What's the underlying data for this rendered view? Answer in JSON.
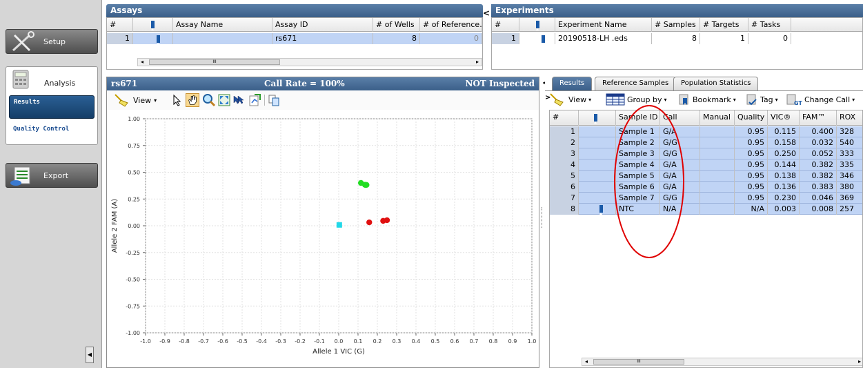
{
  "nav": {
    "setup_label": "Setup",
    "analysis_label": "Analysis",
    "results_label": "Results",
    "qc_label": "Quality Control",
    "export_label": "Export"
  },
  "assays": {
    "title": "Assays",
    "columns": [
      "#",
      "",
      "Assay Name",
      "Assay ID",
      "# of Wells",
      "# of Reference..."
    ],
    "rows": [
      {
        "num": "1",
        "assay_name": "",
        "assay_id": "rs671",
        "wells": "8",
        "ref": "0"
      }
    ]
  },
  "experiments": {
    "title": "Experiments",
    "columns": [
      "#",
      "",
      "Experiment Name",
      "# Samples",
      "# Targets",
      "# Tasks"
    ],
    "rows": [
      {
        "num": "1",
        "name": "20190518-LH  .eds",
        "samples": "8",
        "targets": "1",
        "tasks": "0"
      }
    ]
  },
  "plot": {
    "title": "rs671",
    "call_rate": "Call Rate = 100%",
    "status": "NOT Inspected",
    "view_label": "View"
  },
  "chart_data": {
    "type": "scatter",
    "xlabel": "Allele 1 VIC (G)",
    "ylabel": "Allele 2 FAM (A)",
    "xlim": [
      -1.0,
      1.0
    ],
    "ylim": [
      -1.0,
      1.0
    ],
    "xticks": [
      "-1.0",
      "-0.9",
      "-0.8",
      "-0.7",
      "-0.6",
      "-0.5",
      "-0.4",
      "-0.3",
      "-0.2",
      "-0.1",
      "0.0",
      "0.1",
      "0.2",
      "0.3",
      "0.4",
      "0.5",
      "0.6",
      "0.7",
      "0.8",
      "0.9",
      "1.0"
    ],
    "yticks": [
      "1.00",
      "0.75",
      "0.50",
      "0.25",
      "0.00",
      "-0.25",
      "-0.50",
      "-0.75",
      "-1.00"
    ],
    "grid": true,
    "points": [
      {
        "x": 0.115,
        "y": 0.4,
        "color": "#22dd22",
        "shape": "circle"
      },
      {
        "x": 0.144,
        "y": 0.382,
        "color": "#22dd22",
        "shape": "circle"
      },
      {
        "x": 0.138,
        "y": 0.382,
        "color": "#22dd22",
        "shape": "circle"
      },
      {
        "x": 0.136,
        "y": 0.383,
        "color": "#22dd22",
        "shape": "circle"
      },
      {
        "x": 0.158,
        "y": 0.032,
        "color": "#e01010",
        "shape": "circle"
      },
      {
        "x": 0.25,
        "y": 0.052,
        "color": "#e01010",
        "shape": "circle"
      },
      {
        "x": 0.23,
        "y": 0.046,
        "color": "#e01010",
        "shape": "circle"
      },
      {
        "x": 0.003,
        "y": 0.008,
        "color": "#22d8e8",
        "shape": "square"
      }
    ]
  },
  "results": {
    "tabs": [
      "Results",
      "Reference Samples",
      "Population Statistics"
    ],
    "toolbar": {
      "view": "View",
      "group_by": "Group by",
      "bookmark": "Bookmark",
      "tag": "Tag",
      "change_call": "Change Call"
    },
    "columns": [
      "#",
      "",
      "Sample ID",
      "Call",
      "Manual",
      "Quality",
      "VIC®",
      "FAM™",
      "ROX"
    ],
    "rows": [
      {
        "num": "1",
        "sample": "Sample 1",
        "call": "G/A",
        "manual": "",
        "quality": "0.95",
        "vic": "0.115",
        "fam": "0.400",
        "rox": "328"
      },
      {
        "num": "2",
        "sample": "Sample 2",
        "call": "G/G",
        "manual": "",
        "quality": "0.95",
        "vic": "0.158",
        "fam": "0.032",
        "rox": "540"
      },
      {
        "num": "3",
        "sample": "Sample 3",
        "call": "G/G",
        "manual": "",
        "quality": "0.95",
        "vic": "0.250",
        "fam": "0.052",
        "rox": "333"
      },
      {
        "num": "4",
        "sample": "Sample 4",
        "call": "G/A",
        "manual": "",
        "quality": "0.95",
        "vic": "0.144",
        "fam": "0.382",
        "rox": "335"
      },
      {
        "num": "5",
        "sample": "Sample 5",
        "call": "G/A",
        "manual": "",
        "quality": "0.95",
        "vic": "0.138",
        "fam": "0.382",
        "rox": "346"
      },
      {
        "num": "6",
        "sample": "Sample 6",
        "call": "G/A",
        "manual": "",
        "quality": "0.95",
        "vic": "0.136",
        "fam": "0.383",
        "rox": "380"
      },
      {
        "num": "7",
        "sample": "Sample 7",
        "call": "G/G",
        "manual": "",
        "quality": "0.95",
        "vic": "0.230",
        "fam": "0.046",
        "rox": "369"
      },
      {
        "num": "8",
        "sample": "NTC",
        "call": "N/A",
        "manual": "",
        "quality": "N/A",
        "vic": "0.003",
        "fam": "0.008",
        "rox": "257"
      }
    ]
  },
  "scroll_ellipsis": "III",
  "colors": {
    "header_blue": "#3b5f89",
    "selection": "#c0d4f5",
    "annotation_red": "#e00000"
  }
}
